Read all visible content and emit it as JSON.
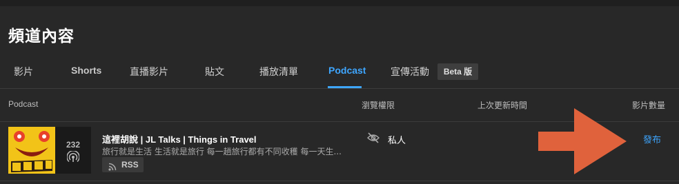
{
  "page": {
    "title": "頻道內容"
  },
  "tabs": [
    {
      "label": "影片"
    },
    {
      "label": "Shorts"
    },
    {
      "label": "直播影片"
    },
    {
      "label": "貼文"
    },
    {
      "label": "播放清單"
    },
    {
      "label": "Podcast",
      "active": true
    },
    {
      "label": "宣傳活動"
    }
  ],
  "beta_badge": "Beta 版",
  "accent_color": "#3ea6ff",
  "columns": {
    "podcast": "Podcast",
    "visibility": "瀏覽權限",
    "last_updated": "上次更新時間",
    "video_count": "影片數量"
  },
  "row": {
    "count": "232",
    "title": "這裡胡說 | JL Talks | Things in Travel",
    "description": "旅行就是生活 生活就是旅行 每一趟旅行都有不同收穫 每一天生...",
    "rss_label": "RSS",
    "visibility": "私人",
    "visibility_icon": "eye-off-icon",
    "action": "發布"
  },
  "annotation": {
    "type": "arrow",
    "color": "#e0623c",
    "direction": "right"
  }
}
